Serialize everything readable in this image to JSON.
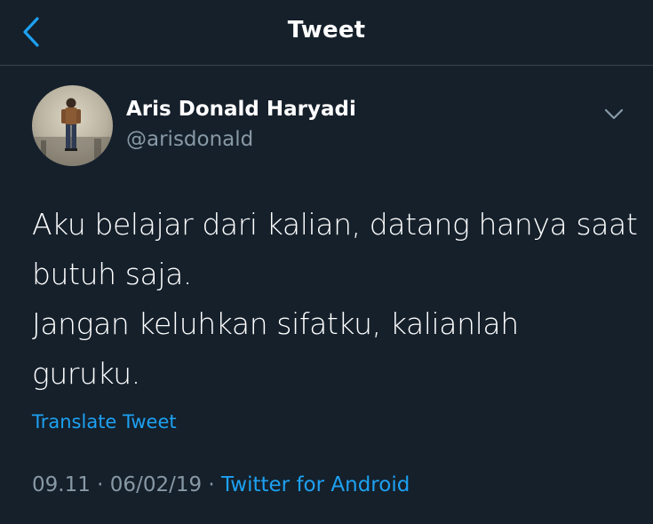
{
  "header": {
    "title": "Tweet",
    "back_icon": "chevron-left-icon"
  },
  "author": {
    "name": "Aris Donald Haryadi",
    "handle": "@arisdonald",
    "menu_icon": "chevron-down-icon"
  },
  "tweet": {
    "lines": [
      "Aku belajar dari kalian, datang hanya saat",
      "butuh saja.",
      "Jangan keluhkan sifatku, kalianlah",
      "guruku."
    ],
    "translate_label": "Translate Tweet",
    "time": "09.11",
    "separator": "·",
    "date": "06/02/19",
    "source": "Twitter for Android"
  },
  "colors": {
    "background": "#15202b",
    "accent": "#1da1f2",
    "muted": "#8899a6",
    "divider": "#38444d"
  }
}
